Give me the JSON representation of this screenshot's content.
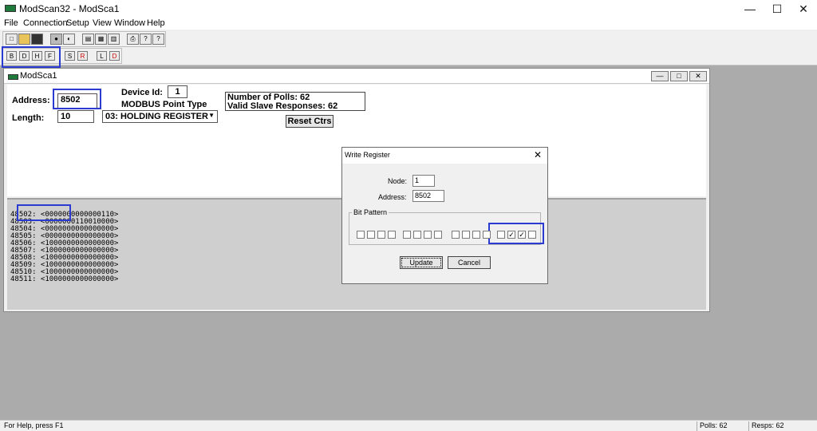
{
  "window": {
    "title": "ModScan32 - ModSca1",
    "minimize": "—",
    "maximize": "☐",
    "close": "✕"
  },
  "menu": [
    "File",
    "Connection",
    "Setup",
    "View",
    "Window",
    "Help"
  ],
  "toolbar": {
    "row1": [
      "new-icon",
      "open-icon",
      "save-icon",
      "connect-icon",
      "disconnect-icon",
      "tile-icon",
      "cascade-icon",
      "arrange-icon",
      "print-icon",
      "help-icon",
      "context-help-icon"
    ],
    "row2": [
      "display-binary",
      "display-decimal",
      "display-hex",
      "display-float",
      "display-swapped",
      "display-reverse",
      "display-long",
      "display-double"
    ],
    "row2_glyphs": [
      "B",
      "D",
      "H",
      "F",
      "S",
      "R",
      "L",
      "D"
    ]
  },
  "child": {
    "title": "ModSca1",
    "address_label": "Address:",
    "address_value": "8502",
    "device_id_label": "Device Id:",
    "device_id_value": "1",
    "point_type_label": "MODBUS Point Type",
    "length_label": "Length:",
    "length_value": "10",
    "point_type_value": "03: HOLDING REGISTER",
    "polls_text": "Number of Polls: 62",
    "responses_text": "Valid Slave Responses: 62",
    "reset_label": "Reset Ctrs",
    "data_lines": [
      "48502: <0000000000000110>",
      "48503: <0000000110010000>",
      "48504: <0000000000000000>",
      "48505: <0000000000000000>",
      "48506: <1000000000000000>",
      "48507: <1000000000000000>",
      "48508: <1000000000000000>",
      "48509: <1000000000000000>",
      "48510: <1000000000000000>",
      "48511: <1000000000000000>"
    ]
  },
  "dialog": {
    "title": "Write Register",
    "node_label": "Node:",
    "node_value": "1",
    "address_label": "Address:",
    "address_value": "8502",
    "bit_pattern_label": "Bit Pattern",
    "bits": [
      0,
      0,
      0,
      0,
      0,
      0,
      0,
      0,
      0,
      0,
      0,
      0,
      0,
      1,
      1,
      0
    ],
    "update_label": "Update",
    "cancel_label": "Cancel"
  },
  "status": {
    "help_text": "For Help, press F1",
    "polls": "Polls: 62",
    "resps": "Resps: 62"
  },
  "colors": {
    "highlight": "#2b3bd1",
    "app_background": "#ababab",
    "data_background": "#cfcfcf"
  }
}
